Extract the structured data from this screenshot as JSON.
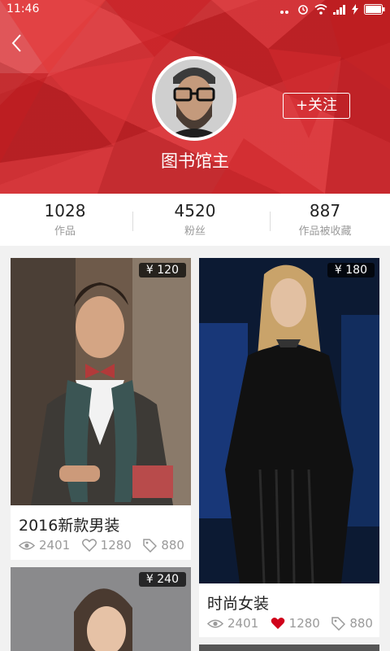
{
  "status_bar": {
    "time": "11:46"
  },
  "profile": {
    "name": "图书馆主",
    "follow_label": "+关注"
  },
  "stats": [
    {
      "value": "1028",
      "label": "作品"
    },
    {
      "value": "4520",
      "label": "粉丝"
    },
    {
      "value": "887",
      "label": "作品被收藏"
    }
  ],
  "cards": [
    {
      "price": "¥ 120",
      "title": "2016新款男装",
      "views": "2401",
      "likes": "1280",
      "likes_active": false,
      "tags": "880"
    },
    {
      "price": "¥ 180",
      "title": "时尚女装",
      "views": "2401",
      "likes": "1280",
      "likes_active": true,
      "tags": "880"
    },
    {
      "price": "¥ 240"
    }
  ],
  "colors": {
    "accent": "#d8262a",
    "heart_active": "#d0021b"
  },
  "icons": [
    "back-arrow-icon",
    "eye-icon",
    "heart-icon",
    "tag-icon",
    "wifi-icon",
    "battery-icon"
  ]
}
